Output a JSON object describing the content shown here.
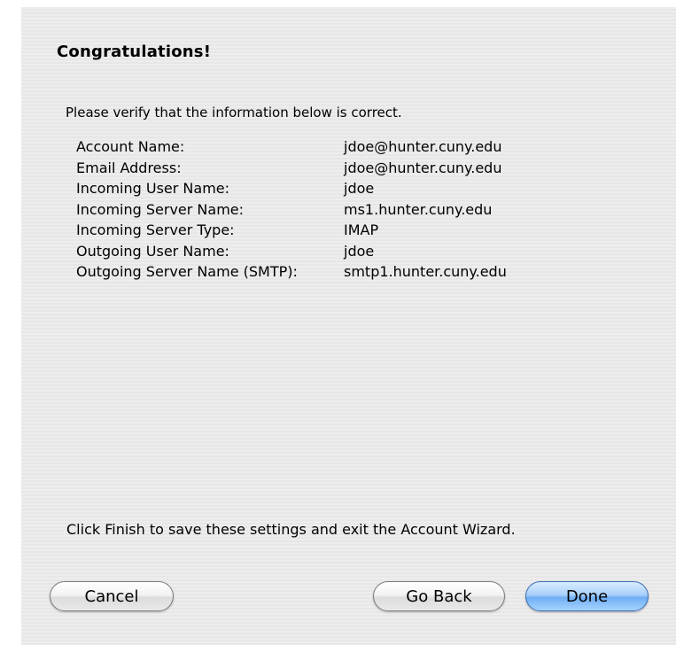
{
  "dialog": {
    "title": "Congratulations!",
    "intro": "Please verify that the information below is correct.",
    "details": [
      {
        "label": "Account Name:",
        "value": "jdoe@hunter.cuny.edu"
      },
      {
        "label": "Email Address:",
        "value": "jdoe@hunter.cuny.edu"
      },
      {
        "label": "Incoming User Name:",
        "value": "jdoe"
      },
      {
        "label": "Incoming Server Name:",
        "value": "ms1.hunter.cuny.edu"
      },
      {
        "label": "Incoming Server Type:",
        "value": "IMAP"
      },
      {
        "label": "Outgoing User Name:",
        "value": "jdoe"
      },
      {
        "label": "Outgoing Server Name (SMTP):",
        "value": "smtp1.hunter.cuny.edu"
      }
    ],
    "footer": "Click Finish to save these settings and exit the Account Wizard."
  },
  "buttons": {
    "cancel": "Cancel",
    "back": "Go Back",
    "done": "Done"
  },
  "colors": {
    "default_button": "#6faff4",
    "background": "#ececec"
  }
}
